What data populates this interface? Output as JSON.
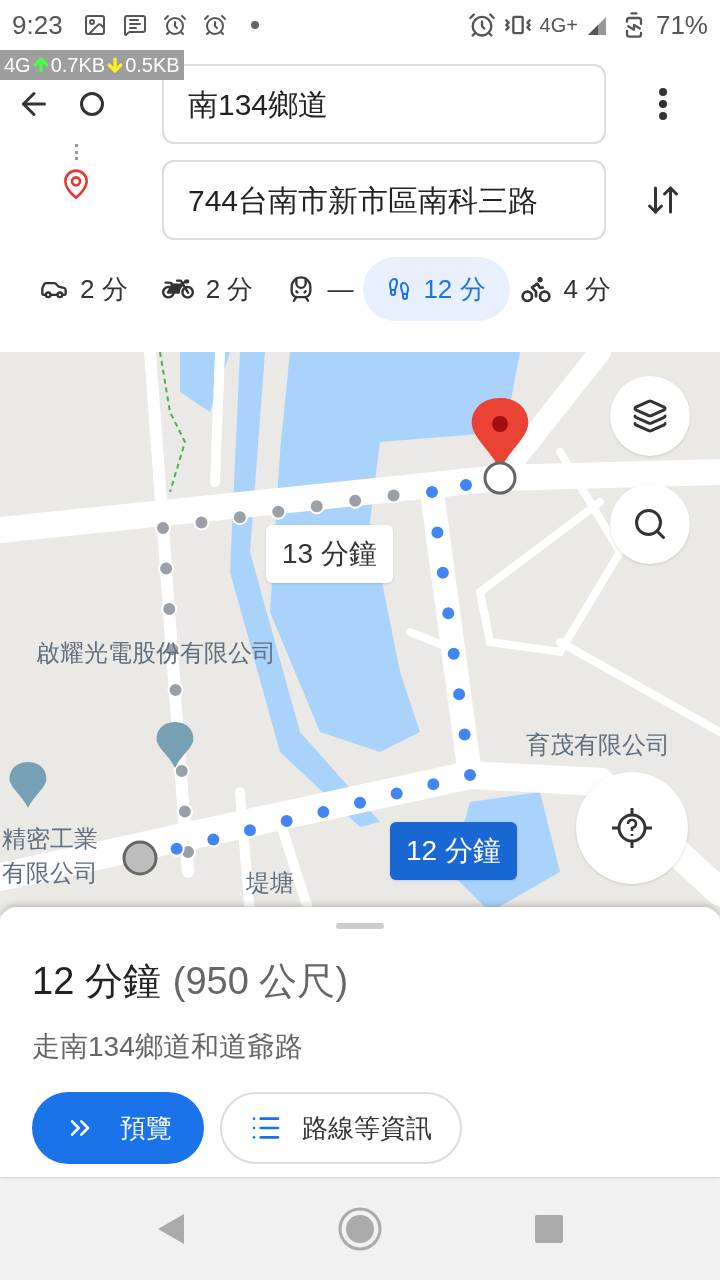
{
  "status_bar": {
    "time": "9:23",
    "network": "4G+",
    "battery": "71%"
  },
  "speed_overlay": {
    "network": "4G",
    "upload": "0.7KB",
    "download": "0.5KB"
  },
  "directions": {
    "origin": "南134鄉道",
    "destination": "744台南市新市區南科三路"
  },
  "modes": [
    {
      "kind": "car",
      "label": "2 分",
      "selected": false
    },
    {
      "kind": "motorcycle",
      "label": "2 分",
      "selected": false
    },
    {
      "kind": "transit",
      "label": "—",
      "selected": false
    },
    {
      "kind": "walk",
      "label": "12 分",
      "selected": true
    },
    {
      "kind": "bike",
      "label": "4 分",
      "selected": false
    }
  ],
  "map": {
    "labels": [
      "啟耀光電股份有限公司",
      "育茂有限公司",
      "精密工業",
      "有限公司",
      "堤塘"
    ],
    "alternate_duration": "13 分鐘",
    "primary_duration": "12 分鐘"
  },
  "sheet": {
    "duration": "12 分鐘",
    "distance": "(950 公尺)",
    "via": "走南134鄉道和道爺路",
    "buttons": [
      {
        "kind": "preview",
        "label": "預覽"
      },
      {
        "kind": "steps",
        "label": "路線等資訊"
      }
    ]
  }
}
